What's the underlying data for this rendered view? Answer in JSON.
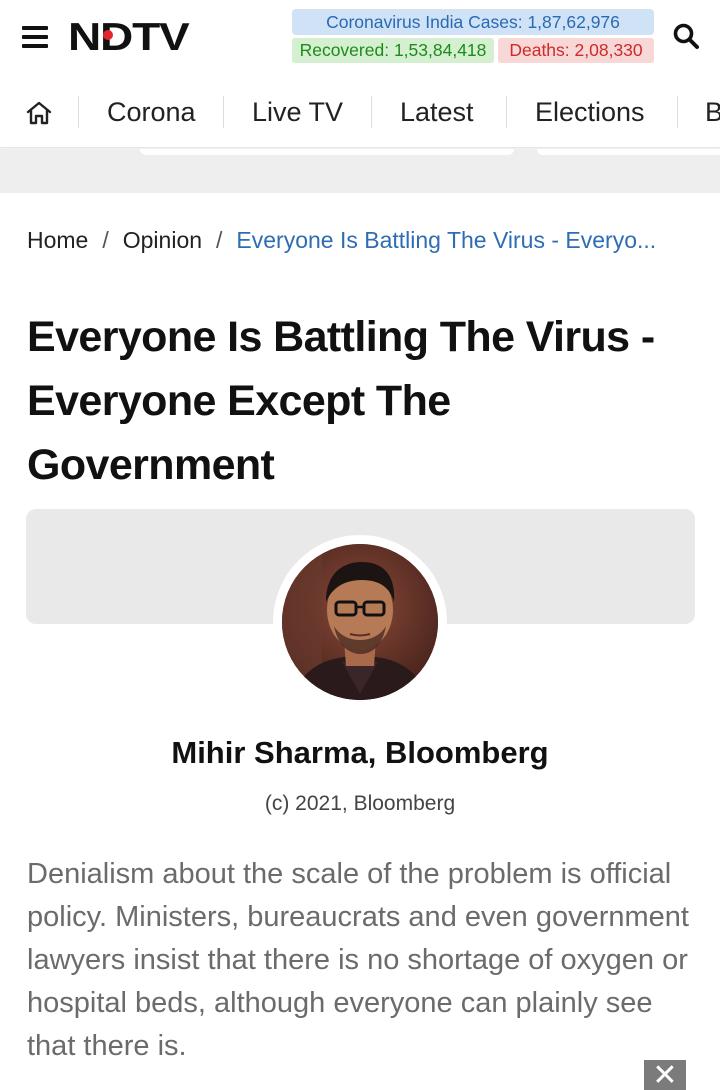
{
  "header": {
    "logo_text": "NDTV",
    "stats": {
      "cases_label": "Coronavirus India Cases:",
      "cases_value": "1,87,62,976",
      "recovered_label": "Recovered:",
      "recovered_value": "1,53,84,418",
      "deaths_label": "Deaths:",
      "deaths_value": "2,08,330"
    },
    "icons": {
      "menu": "hamburger-menu-icon",
      "search": "search-icon"
    }
  },
  "nav": {
    "home_icon": "home-icon",
    "items": [
      {
        "label": "Corona"
      },
      {
        "label": "Live TV"
      },
      {
        "label": "Latest"
      },
      {
        "label": "Elections"
      },
      {
        "label": "B"
      }
    ]
  },
  "breadcrumb": {
    "home": "Home",
    "section": "Opinion",
    "current": "Everyone Is Battling The Virus - Everyo..."
  },
  "article": {
    "title": "Everyone Is Battling The Virus - Everyone Except The Government",
    "author": "Mihir Sharma, Bloomberg",
    "credit": "(c) 2021, Bloomberg",
    "lede": "Denialism about the scale of the problem is official policy. Ministers, bureaucrats and even government lawyers insist that there is no shortage of oxygen or hospital beds, although everyone can plainly see that there is."
  },
  "overlay": {
    "close_symbol": "✕"
  },
  "colors": {
    "brand_red": "#e4262b",
    "link_blue": "#2e6db4",
    "cases_bg": "#cfe2f6",
    "recovered_bg": "#d5f0d0",
    "deaths_bg": "#f8d7d7"
  }
}
